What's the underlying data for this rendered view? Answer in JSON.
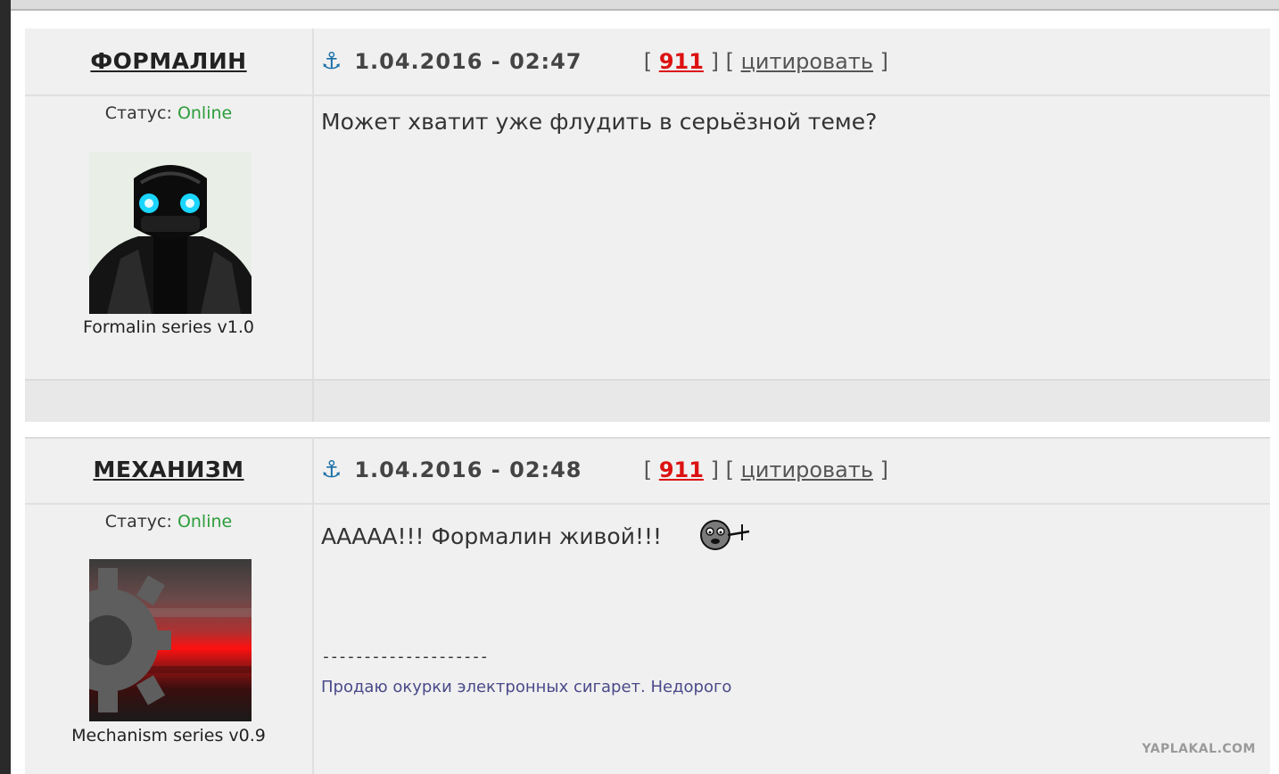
{
  "posts": [
    {
      "author": "ФОРМАЛИН",
      "date": "1.04.2016 - 02:47",
      "post_number": "911",
      "quote_label": "цитировать",
      "status_label": "Статус:",
      "status_value": "Online",
      "avatar_caption": "Formalin series v1.0",
      "message": "Может хватит уже флудить в серьёзной теме?"
    },
    {
      "author": "МЕХАНИЗМ",
      "date": "1.04.2016 - 02:48",
      "post_number": "911",
      "quote_label": "цитировать",
      "status_label": "Статус:",
      "status_value": "Online",
      "avatar_caption": "Mechanism series v0.9",
      "message": "ААААА!!! Формалин живой!!!",
      "signature_separator": "--------------------",
      "signature": "Продаю окурки электронных сигарет. Недорого"
    }
  ],
  "brackets": {
    "open": "[",
    "close": "]"
  },
  "anchor_icon": "⚓",
  "watermark": "YAPLAKAL.COM",
  "colors": {
    "online": "#2d9d3a",
    "post_number": "#dd1111",
    "anchor": "#1a6fa8",
    "signature": "#4a4a8a",
    "background": "#f0f0f0"
  },
  "icons": [
    "anchor-icon",
    "emoticon-icon"
  ]
}
